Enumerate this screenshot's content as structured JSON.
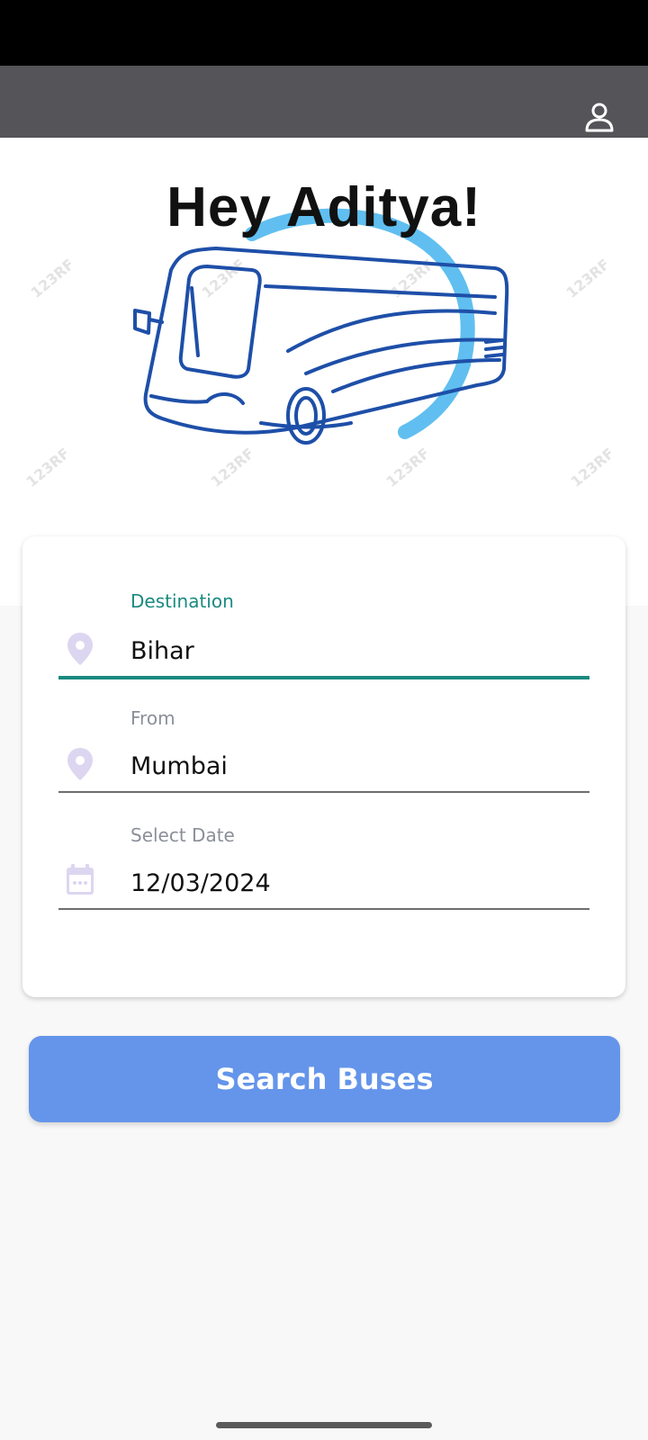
{
  "greeting": "Hey Aditya!",
  "watermark_text": "123RF",
  "form": {
    "destination": {
      "label": "Destination",
      "value": "Bihar",
      "icon": "location-pin-icon"
    },
    "from": {
      "label": "From",
      "value": "Mumbai",
      "icon": "location-pin-icon"
    },
    "date": {
      "label": "Select Date",
      "value": "12/03/2024",
      "icon": "calendar-icon"
    }
  },
  "search_button_label": "Search Buses",
  "colors": {
    "accent": "#1a8a80",
    "button": "#6495ea",
    "app_bar": "#545459",
    "bus_stroke": "#1e4fa8",
    "arc": "#4fb8ee",
    "icon_tint": "#dcd6f0"
  }
}
